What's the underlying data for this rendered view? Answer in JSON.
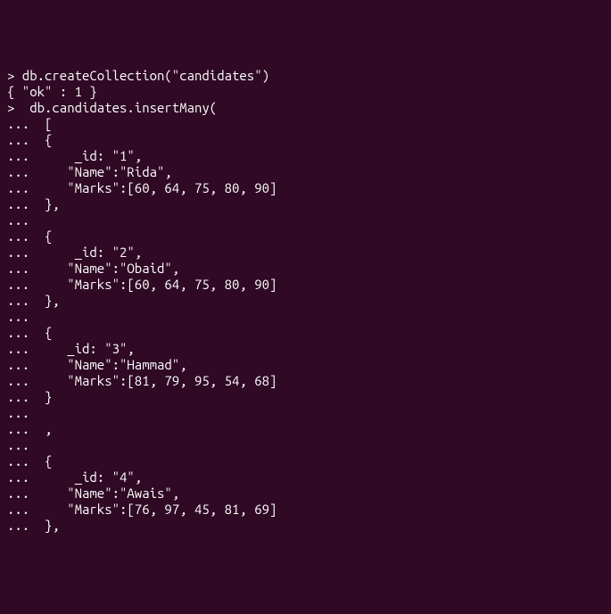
{
  "lines": [
    "> db.createCollection(\"candidates\")",
    "{ \"ok\" : 1 }",
    ">  db.candidates.insertMany(",
    "...  [",
    "...  {",
    "...      _id: \"1\",",
    "...     \"Name\":\"Rida\",",
    "...     \"Marks\":[60, 64, 75, 80, 90]",
    "...  },",
    "...",
    "...  {",
    "...      _id: \"2\",",
    "...     \"Name\":\"Obaid\",",
    "...     \"Marks\":[60, 64, 75, 80, 90]",
    "...  },",
    "...",
    "...  {",
    "...     _id: \"3\",",
    "...     \"Name\":\"Hammad\",",
    "...     \"Marks\":[81, 79, 95, 54, 68]",
    "...  }",
    "...",
    "...  ,",
    "...",
    "...  {",
    "...      _id: \"4\",",
    "...     \"Name\":\"Awais\",",
    "...     \"Marks\":[76, 97, 45, 81, 69]",
    "...  },"
  ]
}
